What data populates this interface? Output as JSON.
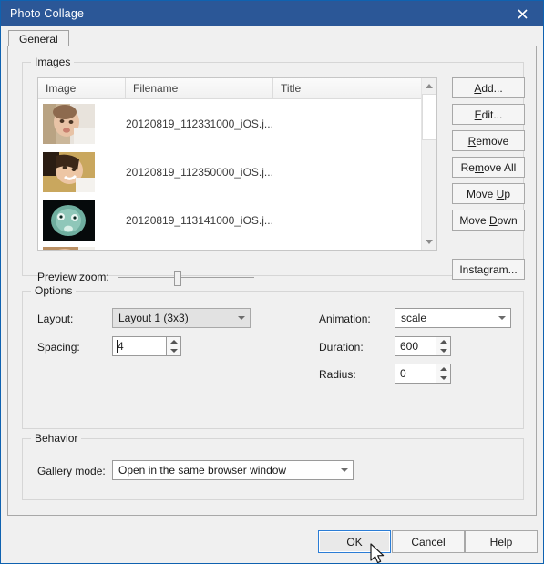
{
  "window": {
    "title": "Photo Collage",
    "close_icon": "close-icon",
    "titlebar_color": "#2b5797",
    "border_color": "#0f62b0"
  },
  "tabs": [
    {
      "label": "General",
      "selected": true
    }
  ],
  "groups": {
    "images": {
      "title": "Images"
    },
    "options": {
      "title": "Options"
    },
    "behavior": {
      "title": "Behavior"
    }
  },
  "images_list": {
    "columns": [
      "Image",
      "Filename",
      "Title"
    ],
    "rows": [
      {
        "filename": "20120819_112331000_iOS.j...",
        "title": "",
        "thumb": "baby-portrait-thumbnail"
      },
      {
        "filename": "20120819_112350000_iOS.j...",
        "title": "",
        "thumb": "child-smiling-thumbnail"
      },
      {
        "filename": "20120819_113141000_iOS.j...",
        "title": "",
        "thumb": "dark-teal-portrait-thumbnail"
      },
      {
        "filename": "",
        "title": "",
        "thumb": "partial-child-thumbnail"
      }
    ],
    "scrollbar": {
      "up_icon": "scroll-up-arrow-icon",
      "down_icon": "scroll-down-arrow-icon",
      "thumb_position_percent": 0
    }
  },
  "side_buttons": [
    {
      "label": "Add...",
      "mnemonic": "A"
    },
    {
      "label": "Edit...",
      "mnemonic": "E"
    },
    {
      "label": "Remove",
      "mnemonic": "R"
    },
    {
      "label": "Remove All",
      "mnemonic": "m"
    },
    {
      "label": "Move Up",
      "mnemonic": "U"
    },
    {
      "label": "Move Down",
      "mnemonic": "D"
    },
    {
      "label": "Instagram...",
      "mnemonic": ""
    }
  ],
  "preview_zoom": {
    "label": "Preview zoom:",
    "value_percent": 42
  },
  "options": {
    "layout": {
      "label": "Layout:",
      "value": "Layout 1 (3x3)",
      "arrow_icon": "chevron-down-icon"
    },
    "spacing": {
      "label": "Spacing:",
      "value": "4"
    },
    "animation": {
      "label": "Animation:",
      "value": "scale",
      "arrow_icon": "chevron-down-icon"
    },
    "duration": {
      "label": "Duration:",
      "value": "600"
    },
    "radius": {
      "label": "Radius:",
      "value": "0"
    }
  },
  "behavior": {
    "gallery_mode": {
      "label": "Gallery mode:",
      "value": "Open in the same browser window",
      "arrow_icon": "chevron-down-icon"
    }
  },
  "bottom_buttons": {
    "ok": "OK",
    "cancel": "Cancel",
    "help": "Help"
  },
  "cursor": {
    "icon": "mouse-pointer-icon"
  }
}
